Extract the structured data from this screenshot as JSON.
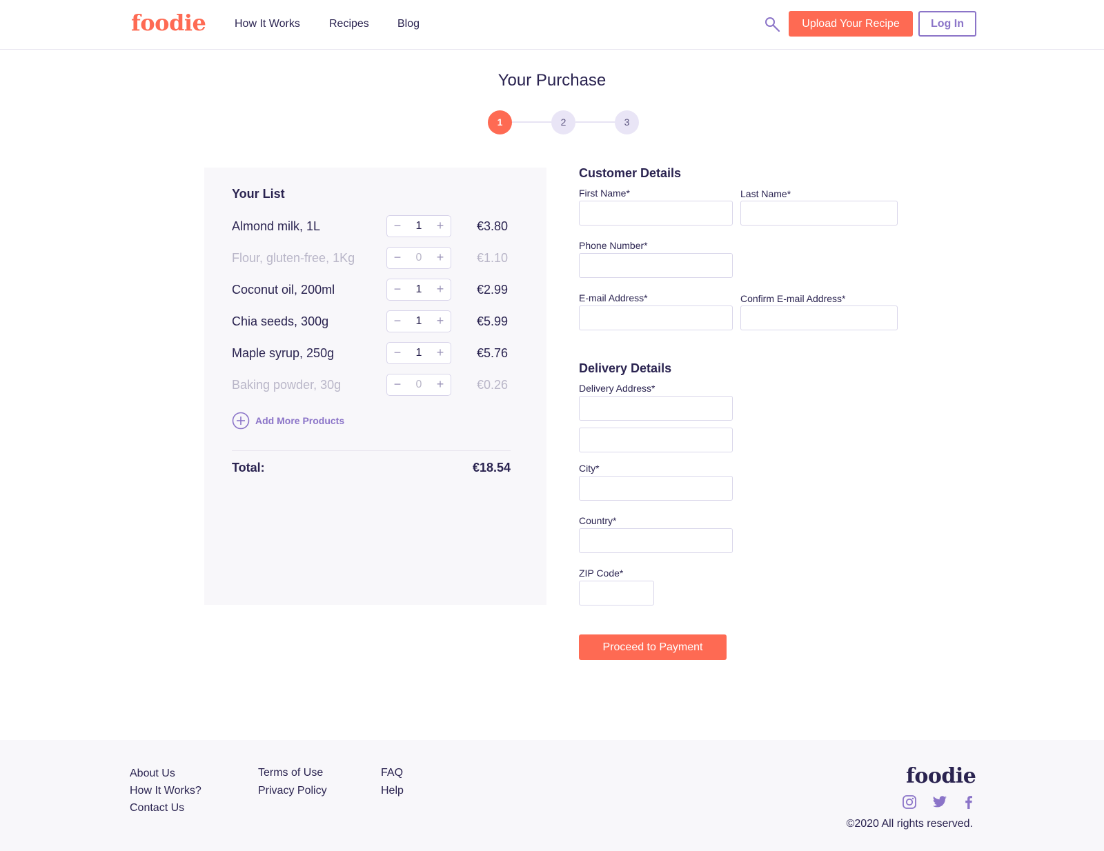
{
  "header": {
    "logo": "foodie",
    "nav": [
      "How It Works",
      "Recipes",
      "Blog"
    ],
    "search_icon": "search-icon",
    "upload_label": "Upload Your Recipe",
    "login_label": "Log In"
  },
  "page": {
    "title": "Your Purchase",
    "steps": [
      "1",
      "2",
      "3"
    ],
    "active_step": 1
  },
  "list": {
    "heading": "Your List",
    "items": [
      {
        "name": "Almond milk, 1L",
        "qty": "1",
        "price": "€3.80"
      },
      {
        "name": "Flour, gluten-free, 1Kg",
        "qty": "0",
        "price": "€1.10"
      },
      {
        "name": "Coconut oil, 200ml",
        "qty": "1",
        "price": "€2.99"
      },
      {
        "name": "Chia seeds, 300g",
        "qty": "1",
        "price": "€5.99"
      },
      {
        "name": "Maple syrup, 250g",
        "qty": "1",
        "price": "€5.76"
      },
      {
        "name": "Baking powder, 30g",
        "qty": "0",
        "price": "€0.26"
      }
    ],
    "minus_symbol": "−",
    "plus_symbol": "+",
    "add_more_label": "Add More Products",
    "total_label": "Total:",
    "total_value": "€18.54"
  },
  "customer": {
    "heading": "Customer Details",
    "first_name_label": "First Name*",
    "last_name_label": "Last Name*",
    "phone_label": "Phone Number*",
    "email_label": "E-mail Address*",
    "confirm_email_label": "Confirm E-mail Address*"
  },
  "delivery": {
    "heading": "Delivery Details",
    "address_label": "Delivery Address*",
    "city_label": "City*",
    "country_label": "Country*",
    "zip_label": "ZIP Code*"
  },
  "proceed_label": "Proceed to Payment",
  "footer": {
    "col1": [
      "About Us",
      "How It Works?",
      "Contact Us"
    ],
    "col2": [
      "Terms of Use",
      "Privacy Policy"
    ],
    "col3": [
      "FAQ",
      "Help"
    ],
    "logo": "foodie",
    "social_icons": [
      "instagram-icon",
      "twitter-icon",
      "facebook-icon"
    ],
    "copyright": "©2020  All rights reserved."
  },
  "colors": {
    "accent": "#fe6a53",
    "brand_dark": "#2a2350",
    "purple": "#8b74c8",
    "panel_bg": "#f8f7fa"
  }
}
